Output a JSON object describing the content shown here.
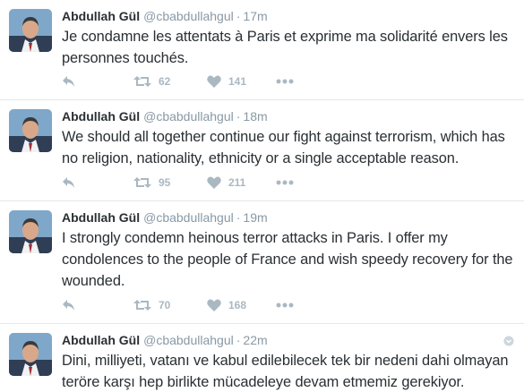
{
  "colors": {
    "name": "#292f33",
    "meta": "#8899a6",
    "action_icon": "#aab8c2",
    "divider": "#e1e8ed"
  },
  "icons": {
    "reply": "reply-arrow-icon",
    "retweet": "retweet-icon",
    "like": "heart-icon",
    "more": "ellipsis-icon",
    "caret": "chevron-down-icon"
  },
  "tweets": [
    {
      "name": "Abdullah Gül",
      "handle": "@cbabdullahgul",
      "separator": "·",
      "time": "17m",
      "text": "Je condamne les attentats à Paris et exprime ma solidarité envers les personnes touchés.",
      "retweets": "62",
      "likes": "141"
    },
    {
      "name": "Abdullah Gül",
      "handle": "@cbabdullahgul",
      "separator": "·",
      "time": "18m",
      "text": "We should all together continue our fight against terrorism, which has no religion, nationality, ethnicity or a single acceptable reason.",
      "retweets": "95",
      "likes": "211"
    },
    {
      "name": "Abdullah Gül",
      "handle": "@cbabdullahgul",
      "separator": "·",
      "time": "19m",
      "text": "I strongly condemn heinous terror attacks in Paris. I offer my condolences to the people of France and wish speedy recovery for the wounded.",
      "retweets": "70",
      "likes": "168"
    },
    {
      "name": "Abdullah Gül",
      "handle": "@cbabdullahgul",
      "separator": "·",
      "time": "22m",
      "text": "Dini, milliyeti, vatanı ve kabul edilebilecek tek bir nedeni dahi olmayan teröre karşı hep birlikte mücadeleye devam etmemiz gerekiyor."
    }
  ]
}
